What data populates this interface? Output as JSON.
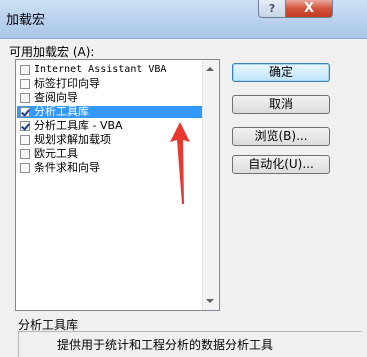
{
  "window": {
    "title": "加载宏",
    "help_glyph": "?",
    "close_glyph": "X"
  },
  "list": {
    "label": "可用加载宏 (A):",
    "items": [
      {
        "label": "Internet Assistant VBA",
        "checked": false,
        "selected": false
      },
      {
        "label": "标签打印向导",
        "checked": false,
        "selected": false
      },
      {
        "label": "查阅向导",
        "checked": false,
        "selected": false
      },
      {
        "label": "分析工具库",
        "checked": true,
        "selected": true
      },
      {
        "label": "分析工具库 - VBA",
        "checked": true,
        "selected": false
      },
      {
        "label": "规划求解加载项",
        "checked": false,
        "selected": false
      },
      {
        "label": "欧元工具",
        "checked": false,
        "selected": false
      },
      {
        "label": "条件求和向导",
        "checked": false,
        "selected": false
      }
    ]
  },
  "buttons": {
    "ok": "确定",
    "cancel": "取消",
    "browse": "浏览(B)...",
    "automation": "自动化(U)..."
  },
  "description": {
    "title": "分析工具库",
    "text": "提供用于统计和工程分析的数据分析工具"
  },
  "annotation": {
    "color": "#e8382f"
  }
}
